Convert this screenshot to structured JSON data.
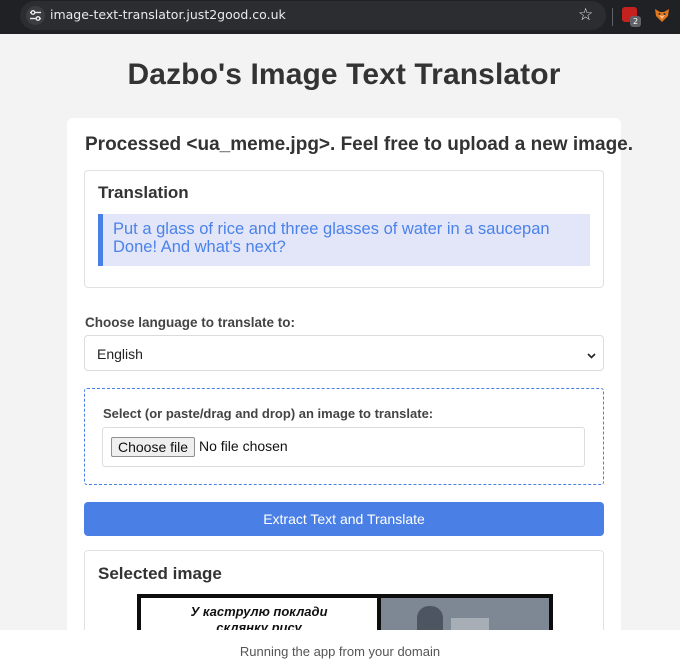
{
  "browser": {
    "url": "image-text-translator.just2good.co.uk",
    "ext_badge": "2",
    "icons": [
      "site-settings-icon",
      "star-icon",
      "extension-icon",
      "fox-icon"
    ]
  },
  "page": {
    "title": "Dazbo's Image Text Translator",
    "processed_message": "Processed <ua_meme.jpg>. Feel free to upload a new image.",
    "translation": {
      "heading": "Translation",
      "lines": [
        "Put a glass of rice and three glasses of water in a saucepan",
        "Done! And what's next?"
      ]
    },
    "language": {
      "label": "Choose language to translate to:",
      "selected": "English"
    },
    "upload": {
      "label": "Select (or paste/drag and drop) an image to translate:",
      "choose_label": "Choose file",
      "status": "No file chosen"
    },
    "submit_label": "Extract Text and Translate",
    "selected_image": {
      "heading": "Selected image",
      "image_text": [
        "У каструлю поклади",
        "склянку рису"
      ]
    }
  },
  "caption": "Running the app from your domain",
  "colors": {
    "accent": "#4a7fe6",
    "quote_background": "#e3e6f8",
    "page_background": "#f3f3f3",
    "chrome": "#202124"
  }
}
